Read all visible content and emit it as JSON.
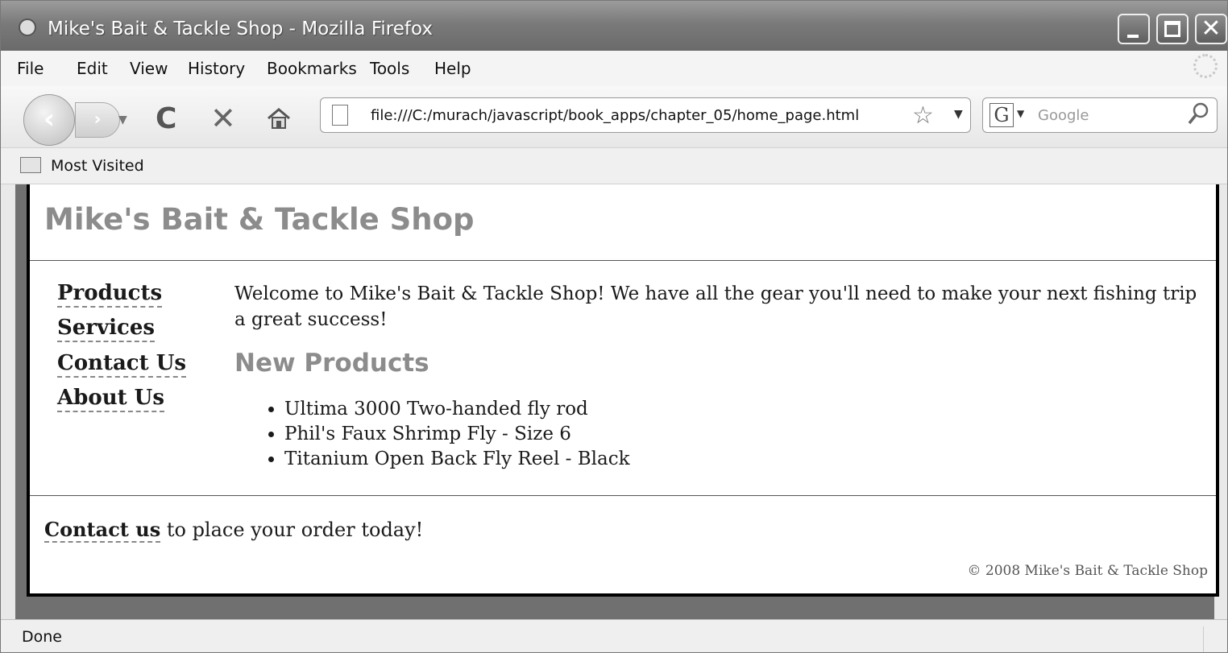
{
  "window": {
    "title": "Mike's Bait & Tackle Shop - Mozilla Firefox",
    "controls": {
      "minimize": "",
      "maximize": "",
      "close": "✕"
    }
  },
  "menu": [
    "File",
    "Edit",
    "View",
    "History",
    "Bookmarks",
    "Tools",
    "Help"
  ],
  "nav": {
    "url": "file:///C:/murach/javascript/book_apps/chapter_05/home_page.html",
    "search_placeholder": "Google",
    "search_engine_letter": "G"
  },
  "bookmarks": {
    "most_visited": "Most Visited"
  },
  "site": {
    "title": "Mike's Bait & Tackle Shop",
    "nav_links": [
      "Products",
      "Services",
      "Contact Us",
      "About Us"
    ],
    "welcome": "Welcome to Mike's Bait & Tackle Shop! We have all the gear you'll need to make your next fishing trip a great success!",
    "new_products_heading": "New Products",
    "products": [
      "Ultima 3000 Two-handed fly rod",
      "Phil's Faux Shrimp Fly - Size 6",
      "Titanium Open Back Fly Reel - Black"
    ],
    "footer_link": "Contact us",
    "footer_text": " to place your order today!",
    "copyright": "© 2008 Mike's Bait & Tackle Shop"
  },
  "status": {
    "text": "Done"
  }
}
